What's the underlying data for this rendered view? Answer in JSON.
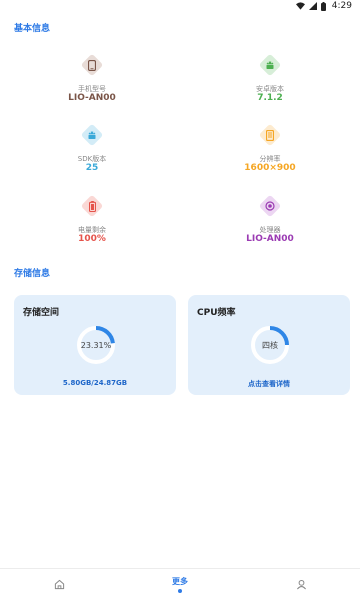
{
  "status_bar": {
    "time": "4:29",
    "icons": [
      "wifi-icon",
      "signal-icon",
      "battery-icon"
    ]
  },
  "sections": {
    "basic_title": "基本信息",
    "storage_title": "存储信息"
  },
  "info_items": [
    {
      "icon": "phone-icon",
      "label": "手机型号",
      "value": "LIO-AN00",
      "color": "#7a5548"
    },
    {
      "icon": "android-icon",
      "label": "安卓版本",
      "value": "7.1.2",
      "color": "#4caf50"
    },
    {
      "icon": "sdk-icon",
      "label": "SDK版本",
      "value": "25",
      "color": "#3aa9d8"
    },
    {
      "icon": "screen-icon",
      "label": "分辨率",
      "value": "1600×900",
      "color": "#f5a623"
    },
    {
      "icon": "battery-level-icon",
      "label": "电量剩余",
      "value": "100%",
      "color": "#e5534b"
    },
    {
      "icon": "processor-icon",
      "label": "处理器",
      "value": "LIO-AN00",
      "color": "#9b3bb3"
    }
  ],
  "storage_card": {
    "title": "存储空间",
    "percent_label": "23.31%",
    "usage_fraction": 0.2331,
    "footer": "5.80GB/24.87GB"
  },
  "cpu_card": {
    "title": "CPU频率",
    "center_label": "四核",
    "footer": "点击查看详情"
  },
  "bottom_nav": {
    "items": [
      {
        "icon": "home-icon",
        "label": ""
      },
      {
        "icon": "",
        "label": "更多"
      },
      {
        "icon": "user-icon",
        "label": ""
      }
    ],
    "active_index": 1
  },
  "colors": {
    "accent": "#2f7be6",
    "card_bg": "#e3effb",
    "ring_fill": "#2f86e6",
    "ring_track": "#ffffff"
  }
}
